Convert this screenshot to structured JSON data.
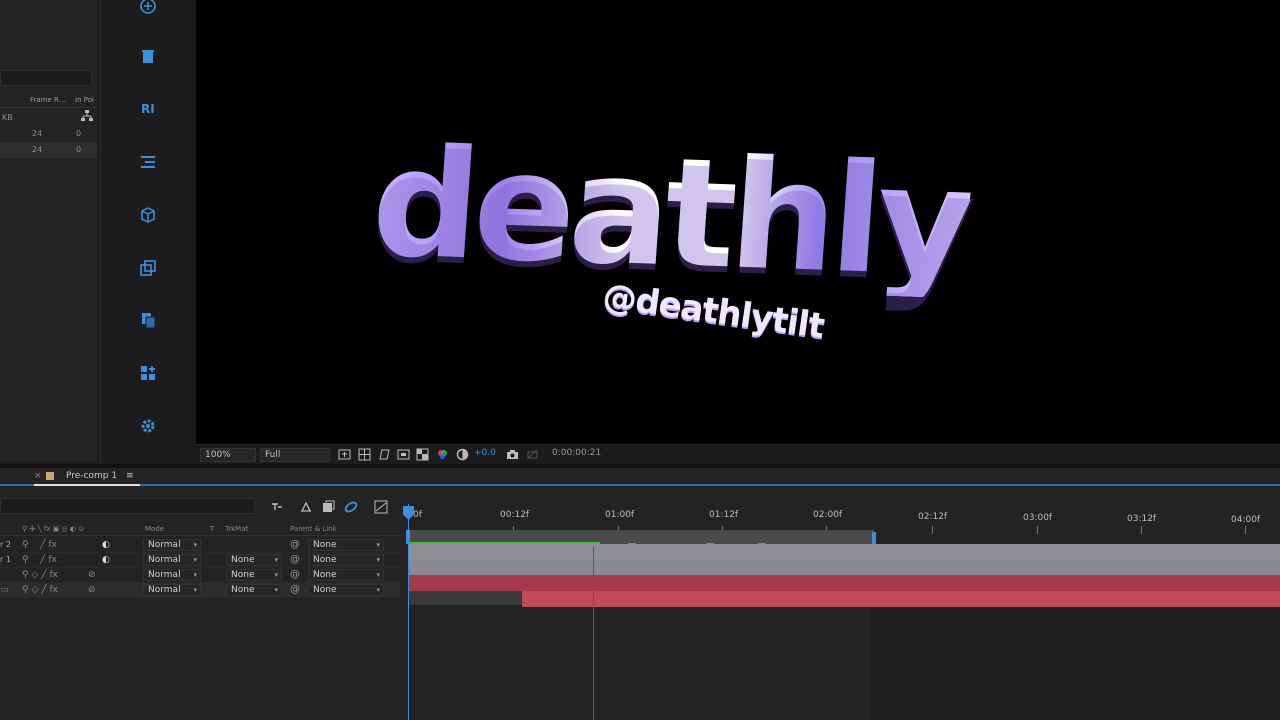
{
  "project_panel": {
    "columns": [
      "Frame R...",
      "In Poi"
    ],
    "rows": [
      {
        "size": "KB",
        "frame_rate": "",
        "in_point": ""
      },
      {
        "size": "",
        "frame_rate": "24",
        "in_point": "0"
      },
      {
        "size": "",
        "frame_rate": "24",
        "in_point": "0"
      }
    ]
  },
  "toolbar": {
    "tools": [
      "add-icon",
      "trash-icon",
      "text-ri-icon",
      "align-icon",
      "cube-icon",
      "duplicate-icon",
      "copy-icon",
      "grid-add-icon",
      "gear-icon"
    ]
  },
  "viewer": {
    "title_text": "deathly",
    "handle_text": "@deathlytilt",
    "zoom": "100%",
    "resolution": "Full",
    "exposure": "+0.0",
    "timecode": "0:00:00:21"
  },
  "timeline": {
    "tab_label": "Pre-comp 1",
    "menu_glyph": "≡",
    "columns": {
      "mode": "Mode",
      "t": "T",
      "trkmat": "TrkMat",
      "parent": "Parent & Link"
    },
    "layers": [
      {
        "name": "r 2",
        "mode": "Normal",
        "trkmat": "",
        "parent": "None"
      },
      {
        "name": "r 1",
        "mode": "Normal",
        "trkmat": "None",
        "parent": "None"
      },
      {
        "name": "",
        "mode": "Normal",
        "trkmat": "None",
        "parent": "None"
      },
      {
        "name": "",
        "mode": "Normal",
        "trkmat": "None",
        "parent": "None"
      }
    ],
    "ruler_labels": [
      "0f",
      "00:12f",
      "01:00f",
      "01:12f",
      "02:00f",
      "02:12f",
      "03:00f",
      "03:12f",
      "04:00f"
    ]
  },
  "colors": {
    "accent_blue": "#3a8fe0",
    "track_gray": "#8f8f9a",
    "track_red": "#b53a48",
    "title_purple": "#9c82ea"
  }
}
